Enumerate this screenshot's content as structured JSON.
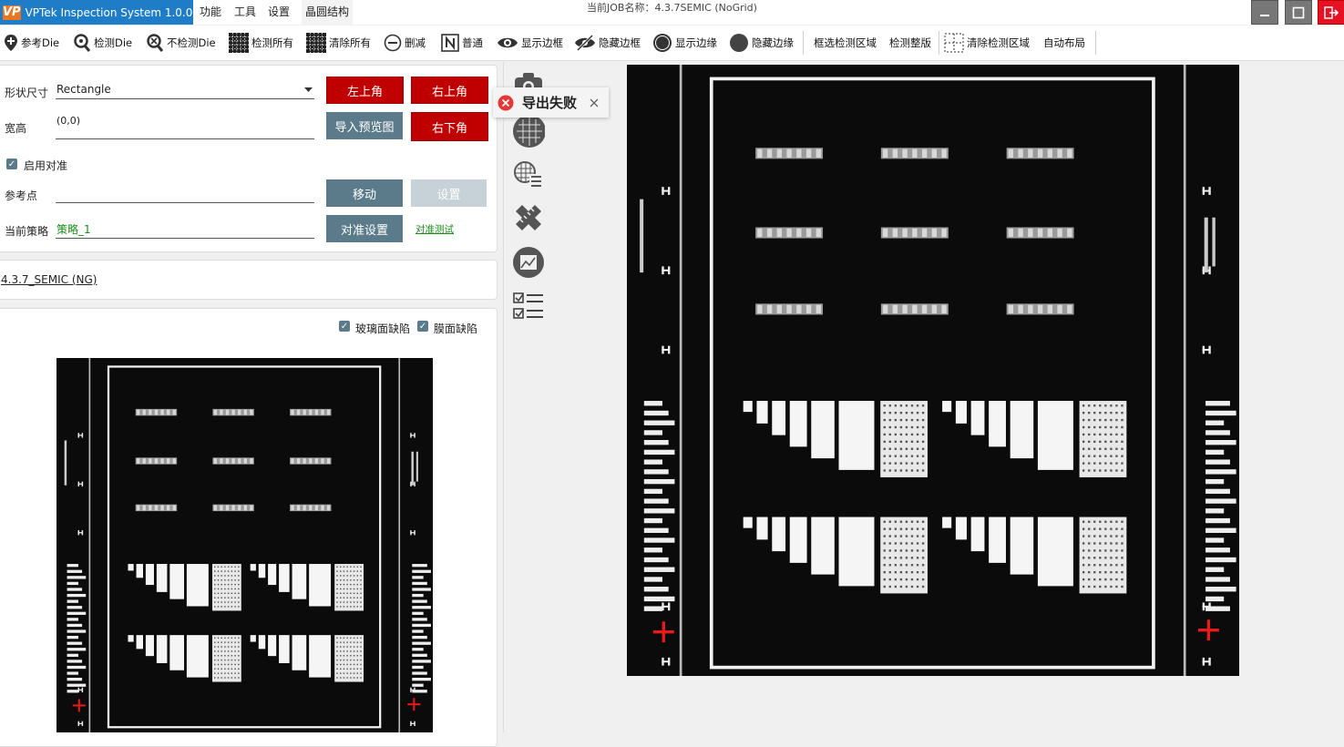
{
  "app": {
    "title": "VPTek Inspection System 1.0.0.0",
    "logo_text": "VP",
    "menu": [
      "功能",
      "工具",
      "设置",
      "晶圆结构"
    ],
    "job_label": "当前JOB名称：4.3.7SEMIC (NoGrid)"
  },
  "window_controls": [
    "minimize-icon",
    "maximize-icon",
    "exit-icon"
  ],
  "toolbar": {
    "ref_die": "参考Die",
    "inspect_die": "检测Die",
    "no_inspect_die": "不检测Die",
    "inspect_all": "检测所有",
    "clear_all": "清除所有",
    "delete": "删减",
    "normal": "普通",
    "show_border": "显示边框",
    "hide_border": "隐藏边框",
    "show_edge": "显示边缘",
    "hide_edge": "隐藏边缘",
    "select_region": "框选检测区域",
    "inspect_layout": "检测整版",
    "clear_region": "清除检测区域",
    "auto_layout": "自动布局"
  },
  "shape_panel": {
    "shape_label": "形状尺寸",
    "shape_value": "Rectangle",
    "size_label": "宽高",
    "size_value": "(0,0)",
    "enable_align_label": "启用对准",
    "enable_align_checked": true,
    "ref_point_label": "参考点",
    "ref_point_value": "",
    "strategy_label": "当前策略",
    "strategy_value": "策略_1",
    "btn_top_left": "左上角",
    "btn_top_right": "右上角",
    "btn_import_preview": "导入预览图",
    "btn_bottom_right": "右下角",
    "btn_move": "移动",
    "btn_set": "设置",
    "btn_align_settings": "对准设置",
    "link_align_test": "对准测试"
  },
  "job_panel": {
    "job_link": "4.3.7_SEMIC (NG)"
  },
  "defect_panel": {
    "glass_defect_label": "玻璃面缺陷",
    "glass_defect_checked": true,
    "film_defect_label": "膜面缺陷",
    "film_defect_checked": true
  },
  "toast": {
    "message": "导出失败",
    "icon": "error-icon"
  },
  "side_tools": [
    "camera-icon",
    "grid-icon",
    "grid-list-icon",
    "ruler-icon",
    "image-chart-icon",
    "checklist-icon"
  ],
  "colors": {
    "brand_blue": "#1f7dc8",
    "red_button": "#c00000",
    "slate_button": "#5c7b8a",
    "green_text": "#1a8a1a",
    "close_red": "#e81123"
  }
}
